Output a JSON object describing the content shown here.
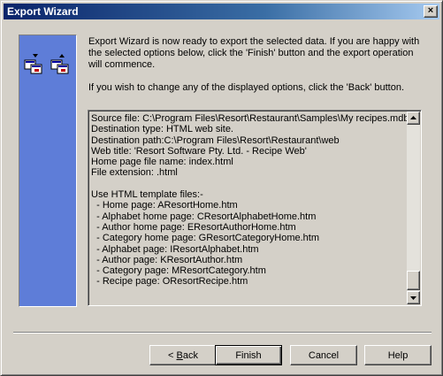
{
  "window": {
    "title": "Export Wizard",
    "close_glyph": "×"
  },
  "intro": {
    "paragraph1": "Export Wizard is now ready to export the selected data.  If you are happy with the selected options below, click the 'Finish' button and the export operation will commence.",
    "paragraph2": "If you wish to change any of the displayed options, click the 'Back' button."
  },
  "summary": {
    "lines": [
      "Source file: C:\\Program Files\\Resort\\Restaurant\\Samples\\My recipes.mdb",
      "Destination type: HTML web site.",
      "Destination path:C:\\Program Files\\Resort\\Restaurant\\web",
      "Web title: 'Resort Software Pty. Ltd. - Recipe Web'",
      "Home page file name: index.html",
      "File extension: .html",
      "",
      "Use HTML template files:-",
      "  - Home page: AResortHome.htm",
      "  - Alphabet home page: CResortAlphabetHome.htm",
      "  - Author home page: EResortAuthorHome.htm",
      "  - Category home page: GResortCategoryHome.htm",
      "  - Alphabet page: IResortAlphabet.htm",
      "  - Author page: KResortAuthor.htm",
      "  - Category page: MResortCategory.htm",
      "  - Recipe page: OResortRecipe.htm"
    ]
  },
  "buttons": {
    "back": {
      "prefix": "< ",
      "mnemonic": "B",
      "rest": "ack"
    },
    "finish": "Finish",
    "cancel": "Cancel",
    "help": "Help"
  },
  "icons": {
    "side": "export-wizard-icon",
    "scroll_up": "scroll-up-arrow-icon",
    "scroll_down": "scroll-down-arrow-icon"
  },
  "colors": {
    "title_bar_start": "#0a246a",
    "side_panel": "#5e7dd8",
    "dialog_face": "#d4d0c8"
  }
}
